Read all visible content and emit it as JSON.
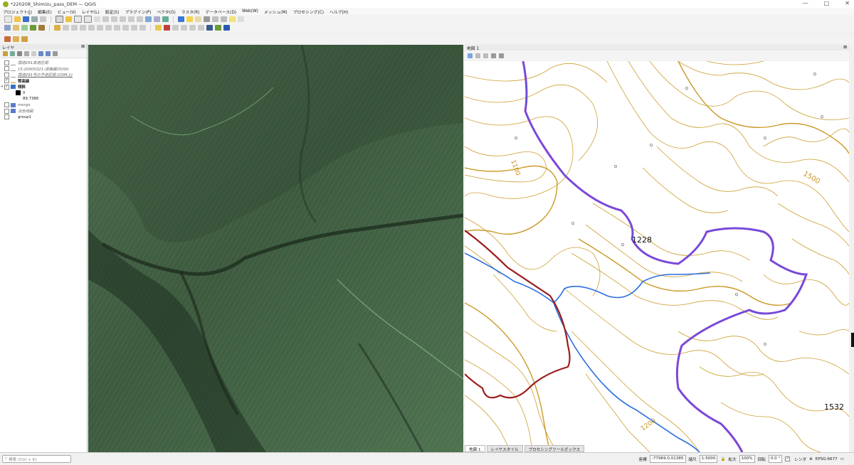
{
  "window": {
    "title": "*220208_Shimizu_pass_DEM — QGIS"
  },
  "menu": [
    "プロジェクト(J)",
    "編集(E)",
    "ビュー(V)",
    "レイヤ(L)",
    "設定(S)",
    "プラグイン(P)",
    "ベクタ(O)",
    "ラスタ(R)",
    "データベース(D)",
    "Web(W)",
    "メッシュ(M)",
    "プロセシング(C)",
    "ヘルプ(H)"
  ],
  "layers_panel": {
    "title": "レイヤ",
    "items": [
      {
        "label": "国道291高道区間"
      },
      {
        "label": "15-20000321-道路縁25000"
      },
      {
        "label": "国道291号の予道区間 (OSM上)"
      },
      {
        "label": "等高線"
      },
      {
        "label": "傾斜"
      },
      {
        "label": "0"
      },
      {
        "label": "89.7386"
      },
      {
        "label": "merge"
      },
      {
        "label": "淡色地図"
      },
      {
        "label": "group1"
      }
    ]
  },
  "map2": {
    "title": "地図 1"
  },
  "map_labels": {
    "top": "1100",
    "elev1": "1228",
    "elev2": "1500",
    "bottom": "1200",
    "elev3": "1532"
  },
  "tabs": [
    "地図 1",
    "レイヤスタイル",
    "プロセシングツールボックス"
  ],
  "status": {
    "search_placeholder": "検索 (Ctrl + K)",
    "coord_label": "座標",
    "coord_value": "-77969.0,01385",
    "scale_label": "縮尺",
    "scale_value": "1:5000",
    "mag_label": "拡大",
    "mag_value": "100%",
    "rot_label": "回転",
    "rot_value": "0.0 °",
    "render_label": "レンダ",
    "crs": "EPSG:6677"
  },
  "colors": {
    "contour": "#c8941a",
    "river": "#2b6fe0",
    "road": "#9b1c1c",
    "trail": "#8e3fd6",
    "hillshade": "#3d5a3f"
  }
}
